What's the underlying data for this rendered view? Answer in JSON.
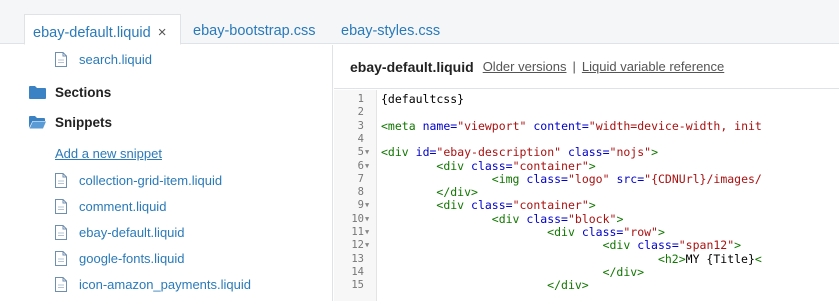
{
  "tabs": [
    {
      "label": "ebay-default.liquid",
      "active": true,
      "closable": true
    },
    {
      "label": "ebay-bootstrap.css",
      "active": false,
      "closable": false
    },
    {
      "label": "ebay-styles.css",
      "active": false,
      "closable": false
    }
  ],
  "tab_close_glyph": "×",
  "sidebar": {
    "top_file": "search.liquid",
    "folders": [
      {
        "label": "Sections",
        "icon": "folder-closed-icon"
      },
      {
        "label": "Snippets",
        "icon": "folder-open-icon"
      }
    ],
    "add_snippet": "Add a new snippet",
    "snippets": [
      "collection-grid-item.liquid",
      "comment.liquid",
      "ebay-default.liquid",
      "google-fonts.liquid",
      "icon-amazon_payments.liquid"
    ]
  },
  "editor": {
    "filename": "ebay-default.liquid",
    "older_versions": "Older versions",
    "separator": "|",
    "liquid_reference": "Liquid variable reference",
    "lines": [
      {
        "n": "1",
        "fold": false,
        "tokens": [
          {
            "t": "{defaultcss}",
            "c": "plain"
          }
        ]
      },
      {
        "n": "2",
        "fold": false,
        "tokens": []
      },
      {
        "n": "3",
        "fold": false,
        "tokens": [
          {
            "t": "<meta",
            "c": "tag"
          },
          {
            "t": " ",
            "c": "plain"
          },
          {
            "t": "name=",
            "c": "attr"
          },
          {
            "t": "\"viewport\"",
            "c": "str"
          },
          {
            "t": " ",
            "c": "plain"
          },
          {
            "t": "content=",
            "c": "attr"
          },
          {
            "t": "\"width=device-width, init",
            "c": "str"
          }
        ]
      },
      {
        "n": "4",
        "fold": false,
        "tokens": []
      },
      {
        "n": "5",
        "fold": true,
        "tokens": [
          {
            "t": "<div",
            "c": "tag"
          },
          {
            "t": " ",
            "c": "plain"
          },
          {
            "t": "id=",
            "c": "attr"
          },
          {
            "t": "\"ebay-description\"",
            "c": "str"
          },
          {
            "t": " ",
            "c": "plain"
          },
          {
            "t": "class=",
            "c": "attr"
          },
          {
            "t": "\"nojs\"",
            "c": "str"
          },
          {
            "t": ">",
            "c": "tag"
          }
        ]
      },
      {
        "n": "6",
        "fold": true,
        "tokens": [
          {
            "t": "        ",
            "c": "plain"
          },
          {
            "t": "<div",
            "c": "tag"
          },
          {
            "t": " ",
            "c": "plain"
          },
          {
            "t": "class=",
            "c": "attr"
          },
          {
            "t": "\"container\"",
            "c": "str"
          },
          {
            "t": ">",
            "c": "tag"
          }
        ]
      },
      {
        "n": "7",
        "fold": false,
        "tokens": [
          {
            "t": "                ",
            "c": "plain"
          },
          {
            "t": "<img",
            "c": "tag"
          },
          {
            "t": " ",
            "c": "plain"
          },
          {
            "t": "class=",
            "c": "attr"
          },
          {
            "t": "\"logo\"",
            "c": "str"
          },
          {
            "t": " ",
            "c": "plain"
          },
          {
            "t": "src=",
            "c": "attr"
          },
          {
            "t": "\"{CDNUrl}/images/",
            "c": "str"
          }
        ]
      },
      {
        "n": "8",
        "fold": false,
        "tokens": [
          {
            "t": "        ",
            "c": "plain"
          },
          {
            "t": "</div>",
            "c": "tag"
          }
        ]
      },
      {
        "n": "9",
        "fold": true,
        "tokens": [
          {
            "t": "        ",
            "c": "plain"
          },
          {
            "t": "<div",
            "c": "tag"
          },
          {
            "t": " ",
            "c": "plain"
          },
          {
            "t": "class=",
            "c": "attr"
          },
          {
            "t": "\"container\"",
            "c": "str"
          },
          {
            "t": ">",
            "c": "tag"
          }
        ]
      },
      {
        "n": "10",
        "fold": true,
        "tokens": [
          {
            "t": "                ",
            "c": "plain"
          },
          {
            "t": "<div",
            "c": "tag"
          },
          {
            "t": " ",
            "c": "plain"
          },
          {
            "t": "class=",
            "c": "attr"
          },
          {
            "t": "\"block\"",
            "c": "str"
          },
          {
            "t": ">",
            "c": "tag"
          }
        ]
      },
      {
        "n": "11",
        "fold": true,
        "tokens": [
          {
            "t": "                        ",
            "c": "plain"
          },
          {
            "t": "<div",
            "c": "tag"
          },
          {
            "t": " ",
            "c": "plain"
          },
          {
            "t": "class=",
            "c": "attr"
          },
          {
            "t": "\"row\"",
            "c": "str"
          },
          {
            "t": ">",
            "c": "tag"
          }
        ]
      },
      {
        "n": "12",
        "fold": true,
        "tokens": [
          {
            "t": "                                ",
            "c": "plain"
          },
          {
            "t": "<div",
            "c": "tag"
          },
          {
            "t": " ",
            "c": "plain"
          },
          {
            "t": "class=",
            "c": "attr"
          },
          {
            "t": "\"span12\"",
            "c": "str"
          },
          {
            "t": ">",
            "c": "tag"
          }
        ]
      },
      {
        "n": "13",
        "fold": false,
        "tokens": [
          {
            "t": "                                        ",
            "c": "plain"
          },
          {
            "t": "<h2>",
            "c": "tag"
          },
          {
            "t": "MY {Title}",
            "c": "plain"
          },
          {
            "t": "<",
            "c": "tag"
          }
        ]
      },
      {
        "n": "14",
        "fold": false,
        "tokens": [
          {
            "t": "                                ",
            "c": "plain"
          },
          {
            "t": "</div>",
            "c": "tag"
          }
        ]
      },
      {
        "n": "15",
        "fold": false,
        "tokens": [
          {
            "t": "                        ",
            "c": "plain"
          },
          {
            "t": "</div>",
            "c": "tag"
          }
        ]
      }
    ]
  },
  "colors": {
    "link": "#2a7ab9",
    "folder": "#3b82c4",
    "tag": "#117700",
    "attr": "#0000cc",
    "string": "#aa1111"
  }
}
